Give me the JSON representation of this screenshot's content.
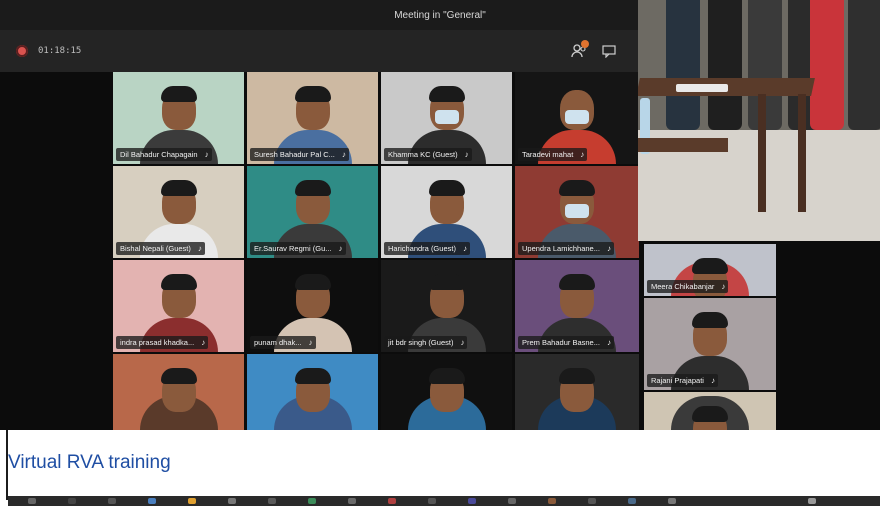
{
  "window": {
    "title": "Meeting in \"General\""
  },
  "toolbar": {
    "timer": "01:18:15",
    "icons": [
      "participants-icon",
      "chat-icon"
    ]
  },
  "participants": [
    {
      "name": "Dil Bahadur Chapagain",
      "bg": "#b9d4c4",
      "shirt": "#3b3b3b",
      "hair": true
    },
    {
      "name": "Suresh Bahadur Pal C...",
      "bg": "#cdb9a2",
      "shirt": "#4a6fa0",
      "hair": true
    },
    {
      "name": "Khamma KC (Guest)",
      "bg": "#c9c9c9",
      "shirt": "#2c2c2c",
      "hair": true,
      "mask": true
    },
    {
      "name": "Taradevi mahat",
      "bg": "#151515",
      "shirt": "#c63d2f",
      "hair": false,
      "mask": true
    },
    {
      "name": "Bishal Nepali (Guest)",
      "bg": "#d7cfc0",
      "shirt": "#e9e9e9",
      "hair": true
    },
    {
      "name": "Er.Saurav Regmi (Gu...",
      "bg": "#2f8c86",
      "shirt": "#3a3a3a",
      "hair": true
    },
    {
      "name": "Harichandra (Guest)",
      "bg": "#d8d8d8",
      "shirt": "#2f4f7a",
      "hair": true
    },
    {
      "name": "Upendra Lamichhane...",
      "bg": "#8f3b33",
      "shirt": "#4a5a6a",
      "hair": true,
      "mask": true
    },
    {
      "name": "indra prasad khadka...",
      "bg": "#e3b3b1",
      "shirt": "#8b2e2e",
      "hair": true
    },
    {
      "name": "punam dhak...",
      "bg": "#0e0e0e",
      "shirt": "#d4c3b3",
      "hair": true
    },
    {
      "name": "jit bdr singh (Guest)",
      "bg": "#1a1a1a",
      "shirt": "#3a3a3a",
      "hair": true
    },
    {
      "name": "Prem Bahadur Basne...",
      "bg": "#6a4e7b",
      "shirt": "#2e2e2e",
      "hair": true
    },
    {
      "name": "",
      "bg": "#b8684a",
      "shirt": "#5a3a2a",
      "hair": true
    },
    {
      "name": "",
      "bg": "#3f8bc4",
      "shirt": "#3a5a8a",
      "hair": true
    },
    {
      "name": "",
      "bg": "#101010",
      "shirt": "#2c6b9a",
      "hair": true
    },
    {
      "name": "",
      "bg": "#2a2a2a",
      "shirt": "#1c3a5a",
      "hair": true
    }
  ],
  "side_participants": [
    {
      "name": "Meera Chikabanjar",
      "bg": "#bfc2cb",
      "shirt": "#c44545",
      "hair": true
    },
    {
      "name": "Rajani Prajapati",
      "bg": "#a9a1a3",
      "shirt": "#2d2d2d",
      "hair": true
    },
    {
      "name": "",
      "bg": "#cfc5b3",
      "shirt": "#3a3a3a",
      "hair": true
    }
  ],
  "caption": "Virtual RVA training",
  "colors": {
    "accent_caption": "#1f4ea3",
    "record": "#d9534f",
    "notification": "#e0732f"
  }
}
